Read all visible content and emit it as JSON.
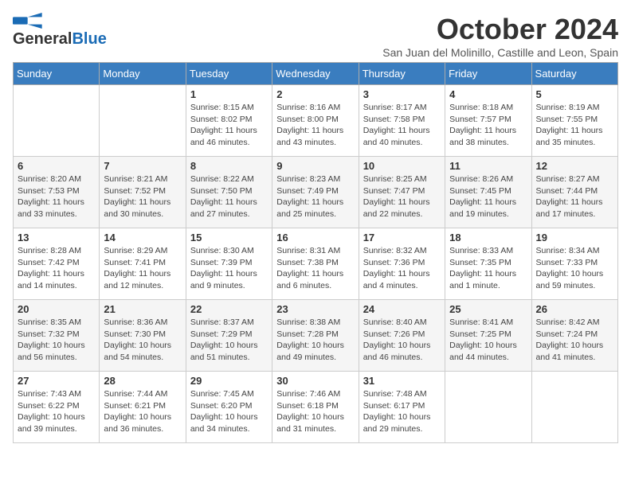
{
  "header": {
    "logo_general": "General",
    "logo_blue": "Blue",
    "month_title": "October 2024",
    "subtitle": "San Juan del Molinillo, Castille and Leon, Spain"
  },
  "days_of_week": [
    "Sunday",
    "Monday",
    "Tuesday",
    "Wednesday",
    "Thursday",
    "Friday",
    "Saturday"
  ],
  "weeks": [
    [
      {
        "day": "",
        "info": ""
      },
      {
        "day": "",
        "info": ""
      },
      {
        "day": "1",
        "info": "Sunrise: 8:15 AM\nSunset: 8:02 PM\nDaylight: 11 hours and 46 minutes."
      },
      {
        "day": "2",
        "info": "Sunrise: 8:16 AM\nSunset: 8:00 PM\nDaylight: 11 hours and 43 minutes."
      },
      {
        "day": "3",
        "info": "Sunrise: 8:17 AM\nSunset: 7:58 PM\nDaylight: 11 hours and 40 minutes."
      },
      {
        "day": "4",
        "info": "Sunrise: 8:18 AM\nSunset: 7:57 PM\nDaylight: 11 hours and 38 minutes."
      },
      {
        "day": "5",
        "info": "Sunrise: 8:19 AM\nSunset: 7:55 PM\nDaylight: 11 hours and 35 minutes."
      }
    ],
    [
      {
        "day": "6",
        "info": "Sunrise: 8:20 AM\nSunset: 7:53 PM\nDaylight: 11 hours and 33 minutes."
      },
      {
        "day": "7",
        "info": "Sunrise: 8:21 AM\nSunset: 7:52 PM\nDaylight: 11 hours and 30 minutes."
      },
      {
        "day": "8",
        "info": "Sunrise: 8:22 AM\nSunset: 7:50 PM\nDaylight: 11 hours and 27 minutes."
      },
      {
        "day": "9",
        "info": "Sunrise: 8:23 AM\nSunset: 7:49 PM\nDaylight: 11 hours and 25 minutes."
      },
      {
        "day": "10",
        "info": "Sunrise: 8:25 AM\nSunset: 7:47 PM\nDaylight: 11 hours and 22 minutes."
      },
      {
        "day": "11",
        "info": "Sunrise: 8:26 AM\nSunset: 7:45 PM\nDaylight: 11 hours and 19 minutes."
      },
      {
        "day": "12",
        "info": "Sunrise: 8:27 AM\nSunset: 7:44 PM\nDaylight: 11 hours and 17 minutes."
      }
    ],
    [
      {
        "day": "13",
        "info": "Sunrise: 8:28 AM\nSunset: 7:42 PM\nDaylight: 11 hours and 14 minutes."
      },
      {
        "day": "14",
        "info": "Sunrise: 8:29 AM\nSunset: 7:41 PM\nDaylight: 11 hours and 12 minutes."
      },
      {
        "day": "15",
        "info": "Sunrise: 8:30 AM\nSunset: 7:39 PM\nDaylight: 11 hours and 9 minutes."
      },
      {
        "day": "16",
        "info": "Sunrise: 8:31 AM\nSunset: 7:38 PM\nDaylight: 11 hours and 6 minutes."
      },
      {
        "day": "17",
        "info": "Sunrise: 8:32 AM\nSunset: 7:36 PM\nDaylight: 11 hours and 4 minutes."
      },
      {
        "day": "18",
        "info": "Sunrise: 8:33 AM\nSunset: 7:35 PM\nDaylight: 11 hours and 1 minute."
      },
      {
        "day": "19",
        "info": "Sunrise: 8:34 AM\nSunset: 7:33 PM\nDaylight: 10 hours and 59 minutes."
      }
    ],
    [
      {
        "day": "20",
        "info": "Sunrise: 8:35 AM\nSunset: 7:32 PM\nDaylight: 10 hours and 56 minutes."
      },
      {
        "day": "21",
        "info": "Sunrise: 8:36 AM\nSunset: 7:30 PM\nDaylight: 10 hours and 54 minutes."
      },
      {
        "day": "22",
        "info": "Sunrise: 8:37 AM\nSunset: 7:29 PM\nDaylight: 10 hours and 51 minutes."
      },
      {
        "day": "23",
        "info": "Sunrise: 8:38 AM\nSunset: 7:28 PM\nDaylight: 10 hours and 49 minutes."
      },
      {
        "day": "24",
        "info": "Sunrise: 8:40 AM\nSunset: 7:26 PM\nDaylight: 10 hours and 46 minutes."
      },
      {
        "day": "25",
        "info": "Sunrise: 8:41 AM\nSunset: 7:25 PM\nDaylight: 10 hours and 44 minutes."
      },
      {
        "day": "26",
        "info": "Sunrise: 8:42 AM\nSunset: 7:24 PM\nDaylight: 10 hours and 41 minutes."
      }
    ],
    [
      {
        "day": "27",
        "info": "Sunrise: 7:43 AM\nSunset: 6:22 PM\nDaylight: 10 hours and 39 minutes."
      },
      {
        "day": "28",
        "info": "Sunrise: 7:44 AM\nSunset: 6:21 PM\nDaylight: 10 hours and 36 minutes."
      },
      {
        "day": "29",
        "info": "Sunrise: 7:45 AM\nSunset: 6:20 PM\nDaylight: 10 hours and 34 minutes."
      },
      {
        "day": "30",
        "info": "Sunrise: 7:46 AM\nSunset: 6:18 PM\nDaylight: 10 hours and 31 minutes."
      },
      {
        "day": "31",
        "info": "Sunrise: 7:48 AM\nSunset: 6:17 PM\nDaylight: 10 hours and 29 minutes."
      },
      {
        "day": "",
        "info": ""
      },
      {
        "day": "",
        "info": ""
      }
    ]
  ]
}
